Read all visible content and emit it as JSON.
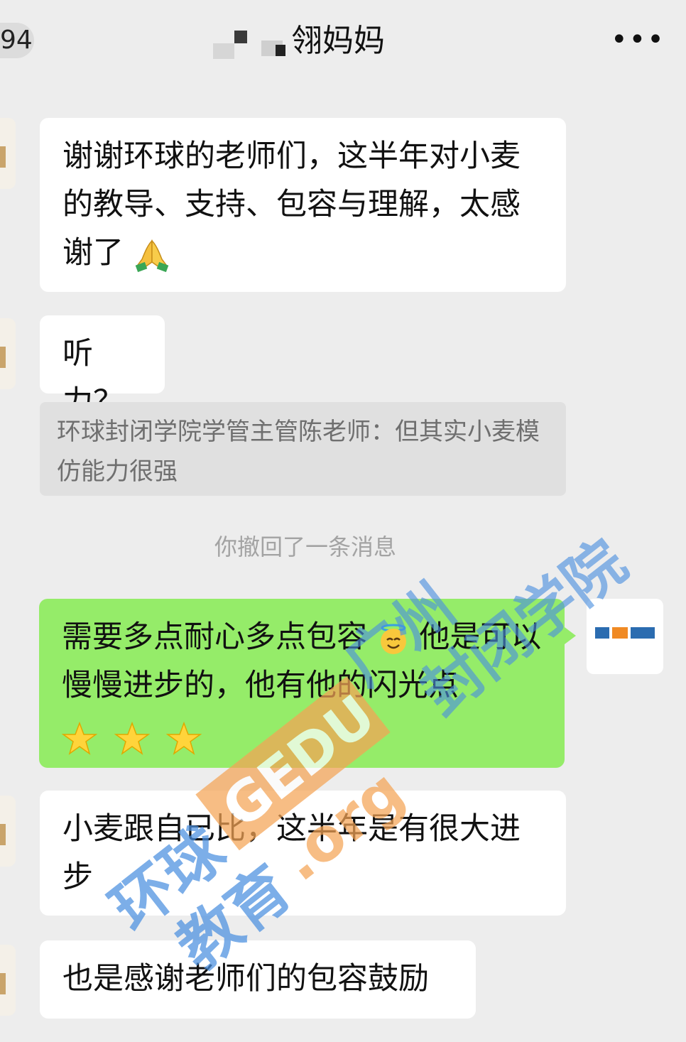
{
  "header": {
    "back_count": "94",
    "title": "翎妈妈",
    "more_label": "•••"
  },
  "messages": [
    {
      "side": "left",
      "text": "谢谢环球的老师们，这半年对小麦的教导、支持、包容与理解，太感谢了",
      "emoji": "folded-hands"
    },
    {
      "side": "left",
      "text": "听力？"
    },
    {
      "quote": "环球封闭学院学管主管陈老师：但其实小麦模仿能力很强"
    },
    {
      "system": "你撤回了一条消息"
    },
    {
      "side": "right",
      "text_a": "需要多点耐心多点包容",
      "text_b": "他是可以慢慢进步的，他有他的闪光点",
      "emojis": [
        "smiling-face-with-halo",
        "star",
        "star",
        "star"
      ]
    },
    {
      "side": "left",
      "text": "小麦跟自已比，这半年是有很大进步"
    },
    {
      "side": "left",
      "text": "也是感谢老师们的包容鼓励"
    }
  ],
  "watermark": {
    "line1": "环球",
    "line2": "教育",
    "brand": "GEDU",
    "domain": ".org",
    "campus_a": "广州",
    "campus_b": "封闭学院"
  },
  "colors": {
    "background": "#ededed",
    "bubble_left": "#ffffff",
    "bubble_right": "#95ec69",
    "quote_bg": "#e0e0e0",
    "watermark_blue": "#2b6cb0",
    "watermark_orange": "#f08a24"
  }
}
